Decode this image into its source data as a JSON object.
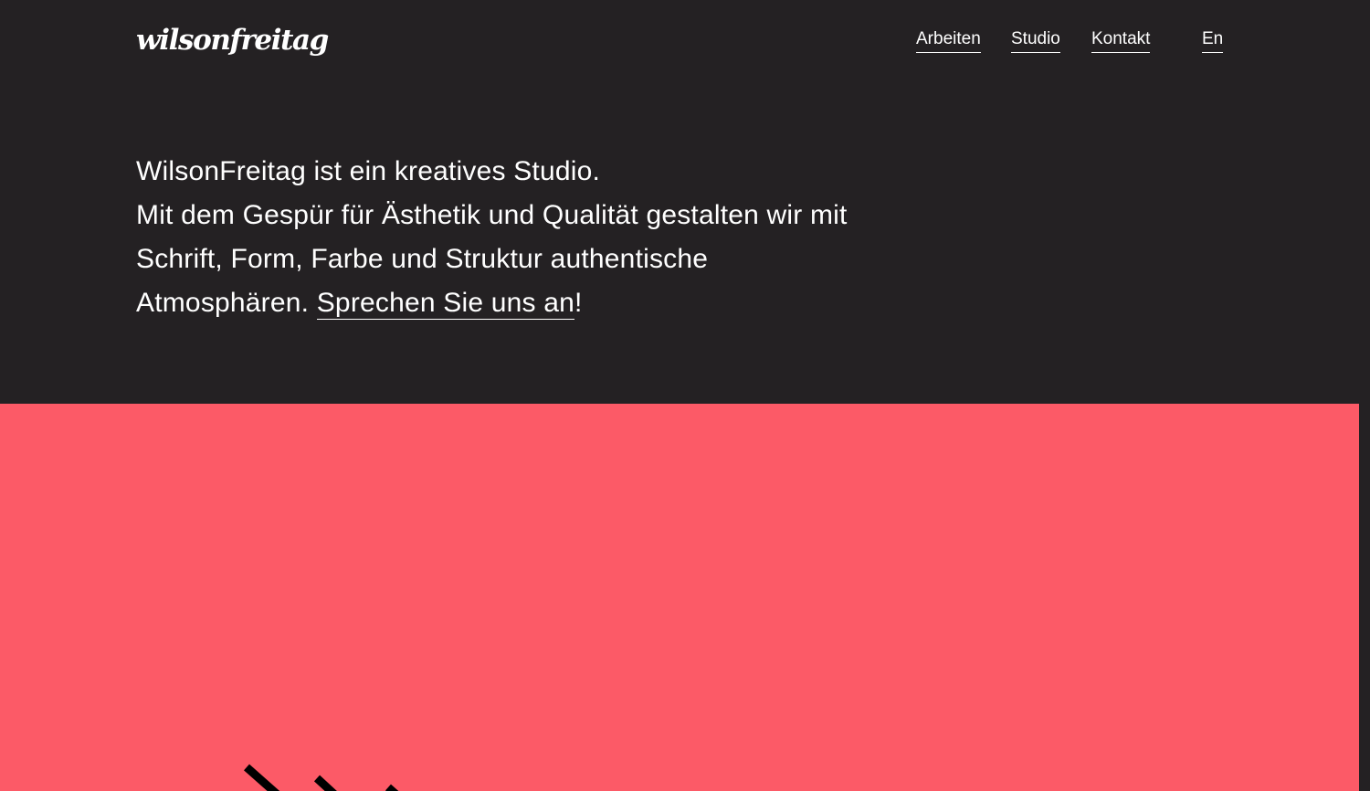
{
  "brand": {
    "logo_text": "wilsonfreitag"
  },
  "nav": {
    "items": [
      {
        "label": "Arbeiten"
      },
      {
        "label": "Studio"
      },
      {
        "label": "Kontakt"
      }
    ],
    "language": "En"
  },
  "intro": {
    "line1": "WilsonFreitag ist ein kreatives Studio.",
    "line2": "Mit dem Gespür für Ästhetik und Qualität gestalten wir mit Schrift, Form, Farbe und Struktur authentische Atmosphären.",
    "cta": "Sprechen Sie uns an",
    "cta_suffix": "!"
  },
  "colors": {
    "background": "#242123",
    "hero": "#fc5a67",
    "text": "#ffffff"
  }
}
